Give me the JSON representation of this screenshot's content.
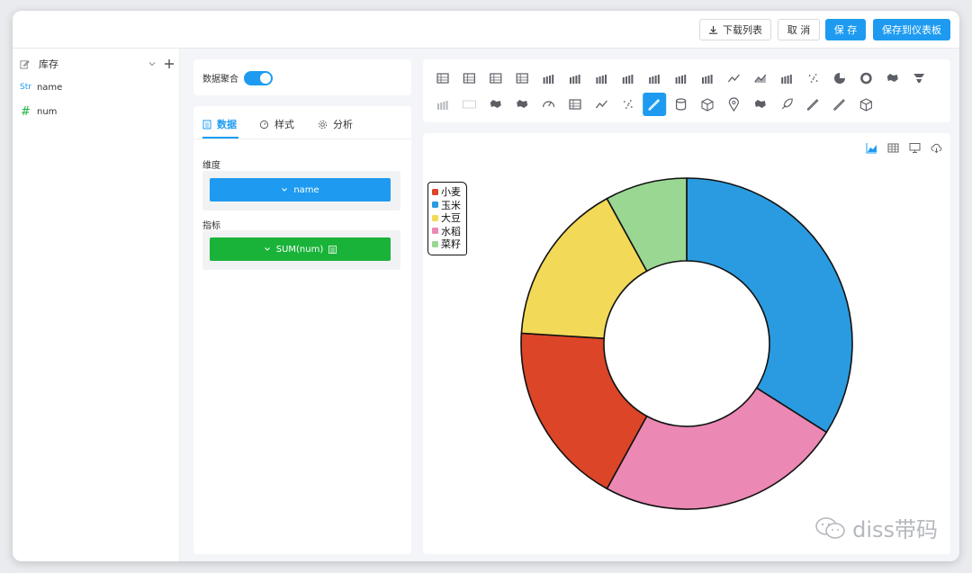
{
  "toolbar": {
    "download_label": "下载列表",
    "cancel_label": "取 消",
    "save_label": "保 存",
    "save_dashboard_label": "保存到仪表板"
  },
  "datasource": {
    "name": "库存",
    "fields": [
      {
        "type_tag": "Str",
        "name": "name"
      },
      {
        "type_tag": "#",
        "name": "num"
      }
    ]
  },
  "config": {
    "aggregate_label": "数据聚合",
    "aggregate_on": true,
    "tabs": [
      {
        "label": "数据",
        "icon": "database-icon",
        "active": true
      },
      {
        "label": "样式",
        "icon": "gauge-icon",
        "active": false
      },
      {
        "label": "分析",
        "icon": "gear-icon",
        "active": false
      }
    ],
    "dimension_label": "维度",
    "dimension_value": "name",
    "measure_label": "指标",
    "measure_value": "SUM(num)",
    "colors": {
      "dimension": "#1e9bf0",
      "measure": "#1ab33a",
      "accent": "#1e9bf0"
    }
  },
  "chart_types": {
    "row1": [
      "table-icon",
      "pivot-table-icon",
      "indicator-card-icon",
      "kpi-card-icon",
      "bar-chart-icon",
      "horizontal-bar-icon",
      "grouped-column-icon",
      "stacked-bar-icon",
      "column-stack-icon",
      "stacked-horizontal-icon",
      "combo-icon",
      "line-icon",
      "area-icon",
      "stacked-area-icon",
      "scatter-icon",
      "pie-icon",
      "donut-icon",
      "treemap-icon",
      "funnel-icon"
    ],
    "row2": [
      "waterfall-icon",
      "word-cloud-icon",
      "map-icon",
      "heat-map-icon",
      "gauge-icon",
      "text-card-icon",
      "sparkline-icon",
      "dot-matrix-icon",
      "pencil-icon",
      "database-icon",
      "cube-icon",
      "location-pin-icon",
      "map-pin-icon",
      "rocket-icon",
      "pen-icon",
      "pencil-alt-icon",
      "box-icon"
    ],
    "selected_index_row2": 8
  },
  "chart_view_tools": [
    "area-chart-icon",
    "grid-icon",
    "present-icon",
    "cloud-download-icon"
  ],
  "chart_data": {
    "type": "pie",
    "variant": "donut",
    "categories": [
      "小麦",
      "玉米",
      "大豆",
      "水稻",
      "菜籽"
    ],
    "values": [
      18,
      34,
      16,
      24,
      8
    ],
    "colors": [
      "#dc4527",
      "#2a9be0",
      "#f2d957",
      "#eb88b4",
      "#99d793"
    ],
    "legend_position": "top-left"
  },
  "watermark": "diss带码"
}
